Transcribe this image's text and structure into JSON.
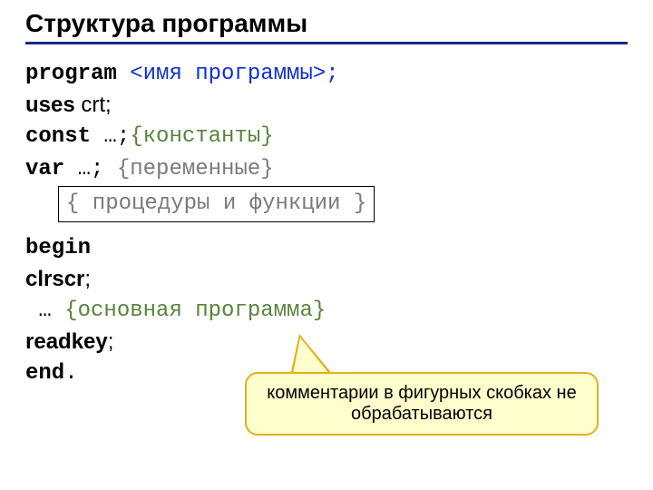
{
  "title": "Структура программы",
  "lines": {
    "l1_kw": "program",
    "l1_rest": " <имя программы>;",
    "l2_kw": "uses",
    "l2_rest": " crt;",
    "l3_kw": "const",
    "l3_rest": " …;",
    "l3_cmt": "{константы}",
    "l4_kw": "var",
    "l4_rest": " …; ",
    "l4_cmt": "{переменные}",
    "l5_cmt": "{ процедуры и функции }",
    "l6_kw": "begin",
    "l7_kw": "clrscr",
    "l7_rest": ";",
    "l8_prefix": " … ",
    "l8_cmt": "{основная программа}",
    "l9_kw": "readkey",
    "l9_rest": ";",
    "l10_kw": "end",
    "l10_rest": "."
  },
  "callout": {
    "line1": "комментарии в фигурных скобках не",
    "line2": "обрабатываются"
  }
}
